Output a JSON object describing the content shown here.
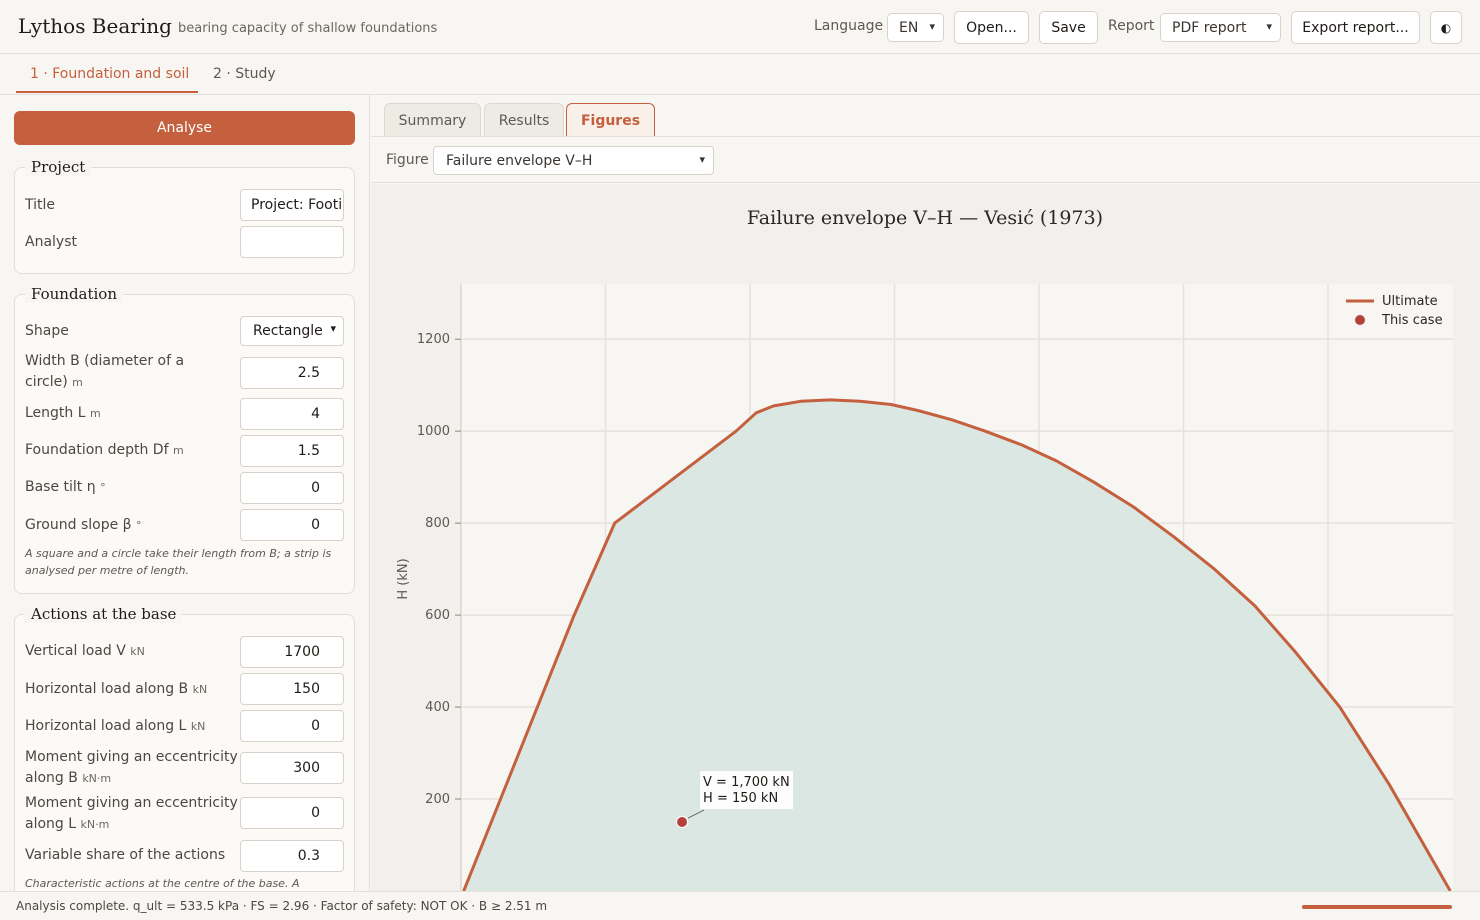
{
  "app": {
    "title": "Lythos Bearing",
    "subtitle": "bearing capacity of shallow foundations"
  },
  "header": {
    "language_label": "Language",
    "language_value": "EN",
    "open_label": "Open...",
    "save_label": "Save",
    "report_label": "Report",
    "report_value": "PDF report",
    "export_label": "Export report...",
    "theme_icon": "◐"
  },
  "steps": [
    {
      "label": "1 · Foundation and soil"
    },
    {
      "label": "2 · Study"
    }
  ],
  "left": {
    "analyse_label": "Analyse",
    "project": {
      "legend": "Project",
      "title_label": "Title",
      "title_value": "Project: Footing",
      "analyst_label": "Analyst",
      "analyst_value": ""
    },
    "foundation": {
      "legend": "Foundation",
      "shape_label": "Shape",
      "shape_value": "Rectangle",
      "width_label": "Width B (diameter of a circle)",
      "width_unit": "m",
      "width_value": "2.5",
      "length_label": "Length L",
      "length_unit": "m",
      "length_value": "4",
      "depth_label": "Foundation depth Df",
      "depth_unit": "m",
      "depth_value": "1.5",
      "tilt_label": "Base tilt η",
      "tilt_unit": "°",
      "tilt_value": "0",
      "slope_label": "Ground slope β",
      "slope_unit": "°",
      "slope_value": "0",
      "note": "A square and a circle take their length from B; a strip is analysed per metre of length."
    },
    "actions": {
      "legend": "Actions at the base",
      "v_label": "Vertical load V",
      "v_unit": "kN",
      "v_value": "1700",
      "hb_label": "Horizontal load along B",
      "hb_unit": "kN",
      "hb_value": "150",
      "hl_label": "Horizontal load along L",
      "hl_unit": "kN",
      "hl_value": "0",
      "mb_label": "Moment giving an eccentricity along B",
      "mb_unit": "kN·m",
      "mb_value": "300",
      "ml_label": "Moment giving an eccentricity along L",
      "ml_unit": "kN·m",
      "ml_value": "0",
      "var_label": "Variable share of the actions",
      "var_value": "0.3",
      "note": "Characteristic actions at the centre of the base. A"
    }
  },
  "view_tabs": [
    {
      "label": "Summary"
    },
    {
      "label": "Results"
    },
    {
      "label": "Figures"
    }
  ],
  "figure": {
    "label": "Figure",
    "value": "Failure envelope V–H"
  },
  "chart_data": {
    "type": "area",
    "title": "Failure envelope V–H — Vesić (1973)",
    "xlabel": "",
    "ylabel": "H (kN)",
    "ylim": [
      0,
      1320
    ],
    "xlim": [
      60,
      7420
    ],
    "yticks": [
      200,
      400,
      600,
      800,
      1000,
      1200
    ],
    "grid": true,
    "legend_position": "top-right",
    "series": [
      {
        "name": "Ultimate",
        "color": "#c4603e",
        "x": [
          80,
          900,
          1200,
          2100,
          2250,
          2380,
          2580,
          2800,
          3020,
          3250,
          3450,
          3700,
          3950,
          4220,
          4480,
          4750,
          5050,
          5350,
          5650,
          5950,
          6250,
          6580,
          6950,
          7400
        ],
        "y": [
          0,
          600,
          800,
          1000,
          1040,
          1055,
          1065,
          1068,
          1065,
          1058,
          1045,
          1025,
          1000,
          970,
          935,
          890,
          835,
          770,
          700,
          620,
          520,
          400,
          230,
          0
        ]
      }
    ],
    "points": [
      {
        "name": "This case",
        "color": "#b5403a",
        "x": 1700,
        "y": 150,
        "label_v": "V = 1,700 kN",
        "label_h": "H = 150 kN"
      }
    ],
    "fill_color": "#dbe7e2"
  },
  "status": {
    "text": "Analysis complete. q_ult = 533.5 kPa · FS = 2.96 · Factor of safety: NOT OK · B ≥ 2.51 m",
    "progress": 1.0
  }
}
